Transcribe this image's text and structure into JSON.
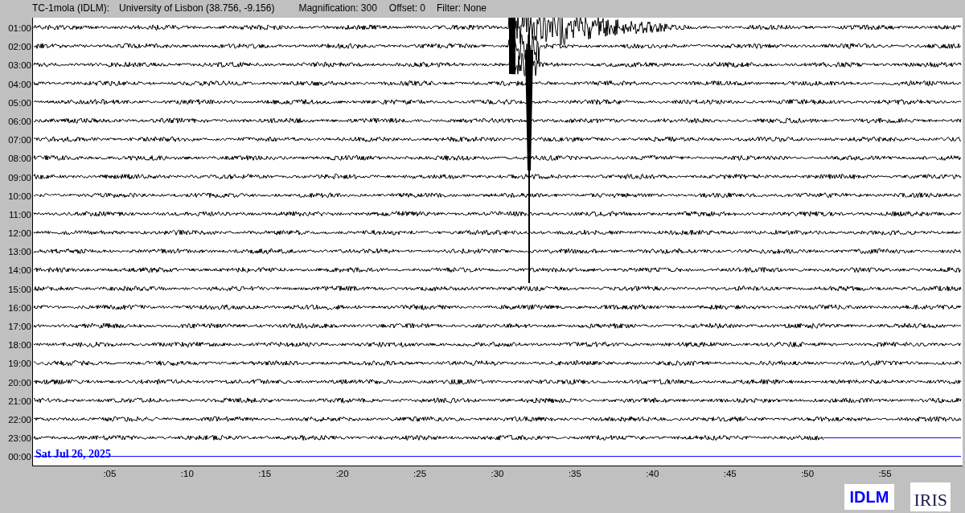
{
  "header": {
    "station": "TC-1mola (IDLM):",
    "location": "University of Lisbon (38.756, -9.156)",
    "magnification": "Magnification: 300",
    "offset": "Offset: 0",
    "filter": "Filter: None"
  },
  "rows": [
    {
      "label": "01:00",
      "kind": "trace"
    },
    {
      "label": "02:00",
      "kind": "trace"
    },
    {
      "label": "03:00",
      "kind": "trace"
    },
    {
      "label": "04:00",
      "kind": "trace"
    },
    {
      "label": "05:00",
      "kind": "trace"
    },
    {
      "label": "06:00",
      "kind": "trace"
    },
    {
      "label": "07:00",
      "kind": "trace"
    },
    {
      "label": "08:00",
      "kind": "trace"
    },
    {
      "label": "09:00",
      "kind": "trace"
    },
    {
      "label": "10:00",
      "kind": "trace"
    },
    {
      "label": "11:00",
      "kind": "trace"
    },
    {
      "label": "12:00",
      "kind": "trace"
    },
    {
      "label": "13:00",
      "kind": "trace"
    },
    {
      "label": "14:00",
      "kind": "trace"
    },
    {
      "label": "15:00",
      "kind": "trace"
    },
    {
      "label": "16:00",
      "kind": "trace"
    },
    {
      "label": "17:00",
      "kind": "trace"
    },
    {
      "label": "18:00",
      "kind": "trace"
    },
    {
      "label": "19:00",
      "kind": "trace"
    },
    {
      "label": "20:00",
      "kind": "trace"
    },
    {
      "label": "21:00",
      "kind": "trace"
    },
    {
      "label": "22:00",
      "kind": "trace"
    },
    {
      "label": "23:00",
      "kind": "partial"
    },
    {
      "label": "00:00",
      "kind": "empty"
    }
  ],
  "date": "Sat Jul 26, 2025",
  "minute_ticks": [
    ":05",
    ":10",
    ":15",
    ":20",
    ":25",
    ":30",
    ":35",
    ":40",
    ":45",
    ":50",
    ":55"
  ],
  "logos": {
    "network": "IDLM",
    "org": "IRIS"
  }
}
